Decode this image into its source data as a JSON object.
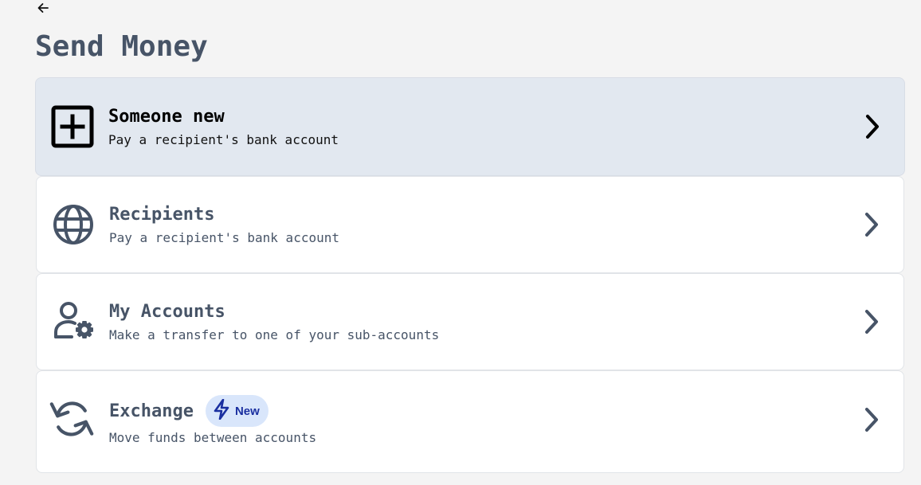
{
  "header": {
    "back_icon": "arrow-left-icon",
    "title": "Send Money"
  },
  "options": [
    {
      "id": "someone-new",
      "icon": "plus-square-icon",
      "title": "Someone new",
      "description": "Pay a recipient's bank account",
      "selected": true
    },
    {
      "id": "recipients",
      "icon": "globe-icon",
      "title": "Recipients",
      "description": "Pay a recipient's bank account",
      "selected": false
    },
    {
      "id": "my-accounts",
      "icon": "user-settings-icon",
      "title": "My Accounts",
      "description": "Make a transfer to one of your sub-accounts",
      "selected": false
    },
    {
      "id": "exchange",
      "icon": "refresh-icon",
      "title": "Exchange",
      "description": "Move funds between accounts",
      "badge": {
        "icon": "lightning-icon",
        "label": "New"
      },
      "selected": false
    }
  ],
  "colors": {
    "background": "#f4f4f4",
    "card": "#ffffff",
    "selected_card": "#e2e8f0",
    "text_primary": "#475467",
    "badge_bg": "#d9e6fb",
    "badge_text": "#1a2fa0"
  }
}
